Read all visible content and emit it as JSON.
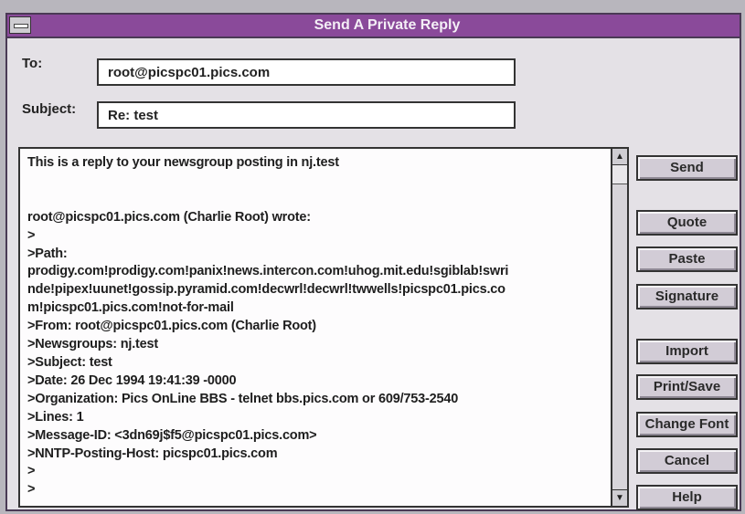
{
  "window": {
    "title": "Send A Private Reply"
  },
  "form": {
    "to_label": "To:",
    "to_value": "root@picspc01.pics.com",
    "subject_label": "Subject:",
    "subject_value": "Re: test"
  },
  "message": {
    "lines": [
      "This is a reply to your newsgroup posting in nj.test",
      "",
      "",
      "root@picspc01.pics.com (Charlie Root) wrote:",
      ">",
      ">Path:",
      "prodigy.com!prodigy.com!panix!news.intercon.com!uhog.mit.edu!sgiblab!swri",
      "nde!pipex!uunet!gossip.pyramid.com!decwrl!decwrl!twwells!picspc01.pics.co",
      "m!picspc01.pics.com!not-for-mail",
      ">From: root@picspc01.pics.com (Charlie Root)",
      ">Newsgroups: nj.test",
      ">Subject: test",
      ">Date: 26 Dec 1994 19:41:39 -0000",
      ">Organization: Pics OnLine BBS - telnet bbs.pics.com or 609/753-2540",
      ">Lines: 1",
      ">Message-ID: <3dn69j$f5@picspc01.pics.com>",
      ">NNTP-Posting-Host: picspc01.pics.com",
      ">",
      ">"
    ]
  },
  "scrollbar": {
    "up_glyph": "▲",
    "down_glyph": "▼"
  },
  "buttons": {
    "send": "Send",
    "quote": "Quote",
    "paste": "Paste",
    "signature": "Signature",
    "import": "Import",
    "print_save": "Print/Save",
    "change_font": "Change Font",
    "cancel": "Cancel",
    "help": "Help"
  },
  "colors": {
    "titlebar": "#8a4a9a",
    "window_bg": "#e4e1e6",
    "button_face": "#d2ccd6"
  }
}
